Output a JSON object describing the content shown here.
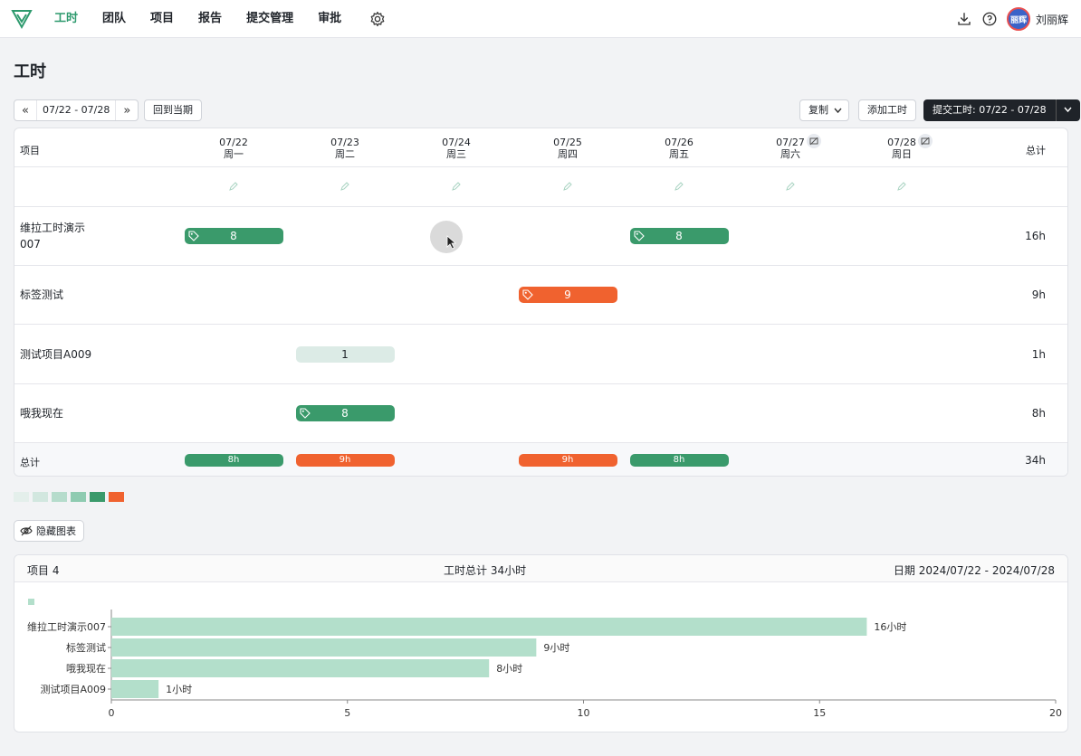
{
  "nav": {
    "items": [
      "工时",
      "团队",
      "项目",
      "报告",
      "提交管理",
      "审批"
    ],
    "active": "工时",
    "username": "刘丽辉",
    "avatar_text": "丽辉"
  },
  "page": {
    "title": "工时"
  },
  "toolbar": {
    "prev_label": "«",
    "range": "07/22 - 07/28",
    "next_label": "»",
    "back_to_current": "回到当期",
    "copy": "复制",
    "add_hours": "添加工时",
    "submit": "提交工时: 07/22 - 07/28"
  },
  "grid": {
    "project_header": "项目",
    "total_header": "总计",
    "days": [
      {
        "date": "07/22",
        "weekday": "周一"
      },
      {
        "date": "07/23",
        "weekday": "周二"
      },
      {
        "date": "07/24",
        "weekday": "周三"
      },
      {
        "date": "07/25",
        "weekday": "周四"
      },
      {
        "date": "07/26",
        "weekday": "周五"
      },
      {
        "date": "07/27",
        "weekday": "周六"
      },
      {
        "date": "07/28",
        "weekday": "周日"
      }
    ],
    "rows": [
      {
        "name": "维拉工时演示007",
        "total": "16h",
        "entries": [
          {
            "day": 0,
            "value": "8",
            "style": "green",
            "tag": true
          },
          {
            "day": 4,
            "value": "8",
            "style": "green",
            "tag": true
          }
        ]
      },
      {
        "name": "标签测试",
        "total": "9h",
        "entries": [
          {
            "day": 3,
            "value": "9",
            "style": "orange",
            "tag": true
          }
        ]
      },
      {
        "name": "测试项目A009",
        "total": "1h",
        "entries": [
          {
            "day": 1,
            "value": "1",
            "style": "light",
            "tag": false
          }
        ]
      },
      {
        "name": "哦我现在",
        "total": "8h",
        "entries": [
          {
            "day": 1,
            "value": "8",
            "style": "green",
            "tag": true
          }
        ]
      }
    ],
    "totals": {
      "label": "总计",
      "days": [
        {
          "day": 0,
          "value": "8h",
          "style": "green"
        },
        {
          "day": 1,
          "value": "9h",
          "style": "orange"
        },
        {
          "day": 3,
          "value": "9h",
          "style": "orange"
        },
        {
          "day": 4,
          "value": "8h",
          "style": "green"
        }
      ],
      "sum": "34h"
    }
  },
  "legend_colors": [
    "#e4efeb",
    "#d2e7df",
    "#b6dccc",
    "#8fcbb1",
    "#3a9a6b",
    "#f0622f"
  ],
  "hide_chart": "隐藏图表",
  "summary": {
    "projects": "项目 4",
    "total_hours": "工时总计 34小时",
    "date_range": "日期 2024/07/22 - 2024/07/28"
  },
  "chart_data": {
    "type": "bar",
    "orientation": "horizontal",
    "categories": [
      "维拉工时演示007",
      "标签测试",
      "哦我现在",
      "测试项目A009"
    ],
    "values": [
      16,
      9,
      8,
      1
    ],
    "value_labels": [
      "16小时",
      "9小时",
      "8小时",
      "1小时"
    ],
    "xlim": [
      0,
      20
    ],
    "xticks": [
      0,
      5,
      10,
      15,
      20
    ],
    "bar_color": "#b3dfcb"
  }
}
